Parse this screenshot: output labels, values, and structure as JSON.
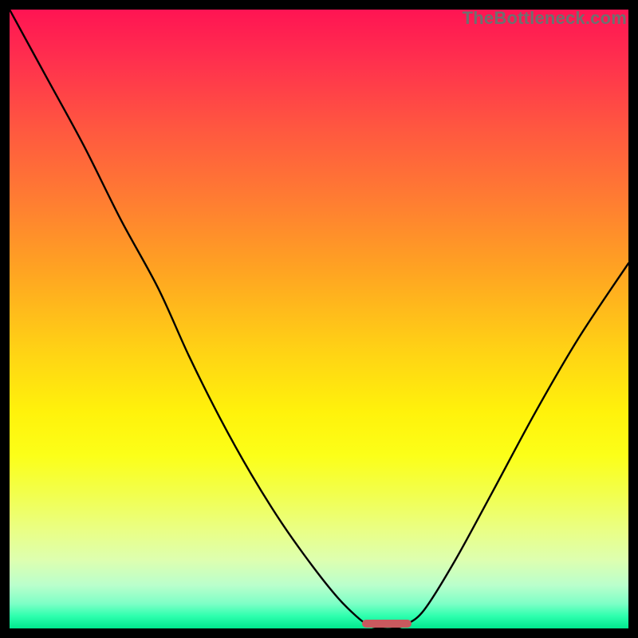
{
  "watermark": "TheBottleneck.com",
  "chart_data": {
    "type": "line",
    "title": "",
    "xlabel": "",
    "ylabel": "",
    "x_range": [
      0,
      100
    ],
    "y_range": [
      0,
      100
    ],
    "x": [
      0,
      6,
      12,
      18,
      24,
      29,
      34,
      39,
      44,
      49,
      53,
      56,
      58,
      60,
      62,
      64,
      67,
      72,
      78,
      85,
      92,
      100
    ],
    "values": [
      100,
      89,
      78,
      66,
      55,
      44,
      34,
      25,
      17,
      10,
      5,
      2,
      0.5,
      0,
      0,
      0.6,
      3,
      11,
      22,
      35,
      47,
      59
    ],
    "optimal_zone": {
      "x_start": 57,
      "x_end": 65,
      "y": 0
    },
    "legend": [],
    "grid": false
  },
  "colors": {
    "curve": "#000000",
    "marker": "#c9595e",
    "gradient_top": "#ff1453",
    "gradient_bottom": "#00e88e",
    "frame": "#000000"
  }
}
